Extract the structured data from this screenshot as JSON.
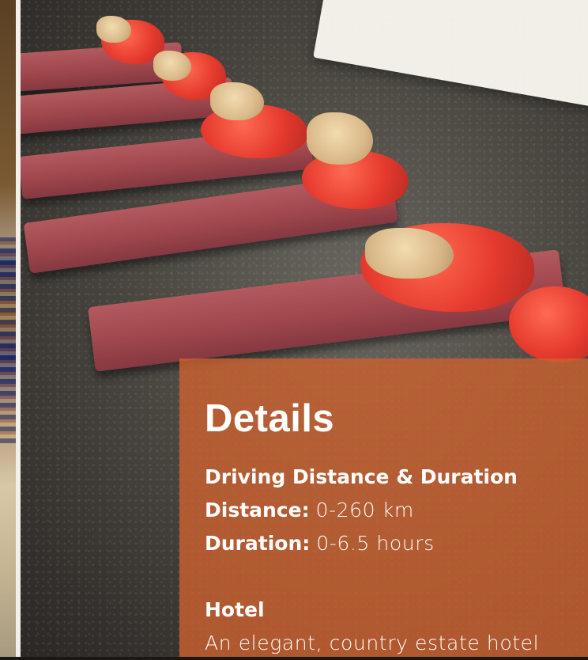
{
  "details": {
    "title": "Details",
    "driving": {
      "heading": "Driving Distance & Duration",
      "distance_label": "Distance:",
      "distance_value": "0-260 km",
      "duration_label": "Duration:",
      "duration_value": "0-6.5 hours"
    },
    "hotel": {
      "heading": "Hotel",
      "description": "An elegant, country estate hotel"
    }
  },
  "colors": {
    "panel_overlay": "#cd6230",
    "text": "#ffffff"
  }
}
